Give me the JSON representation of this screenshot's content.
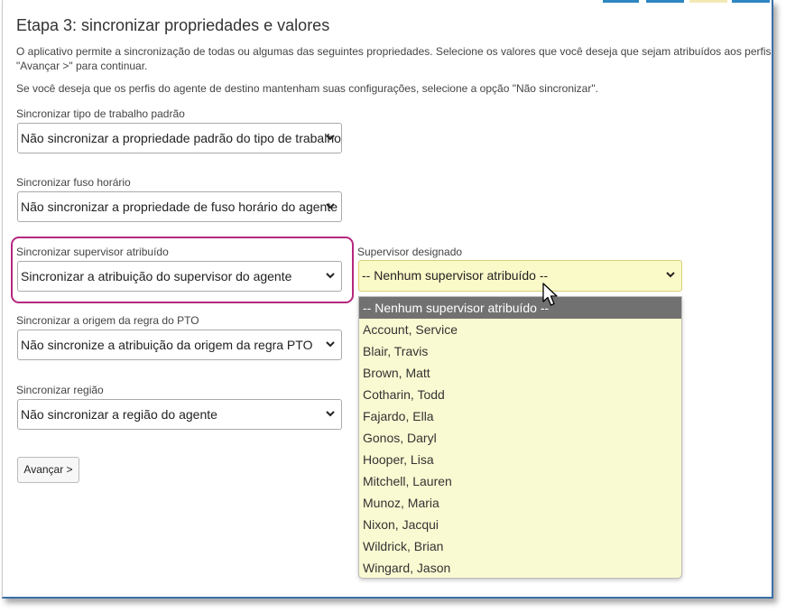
{
  "title": "Etapa 3: sincronizar propriedades e valores",
  "intro": {
    "line1": "O aplicativo permite a sincronização de todas ou algumas das seguintes propriedades. Selecione os valores que você deseja que sejam atribuídos aos perfis de",
    "line2": "\"Avançar >\" para continuar.",
    "line3": "Se você deseja que os perfis do agente de destino mantenham suas configurações, selecione a opção \"Não sincronizar\"."
  },
  "fields": {
    "work_type": {
      "label": "Sincronizar tipo de trabalho padrão",
      "value": "Não sincronizar a propriedade padrão do tipo de trabalho"
    },
    "time_zone": {
      "label": "Sincronizar fuso horário",
      "value": "Não sincronizar a propriedade de fuso horário do agente"
    },
    "supervisor": {
      "label": "Sincronizar supervisor atribuído",
      "value": "Sincronizar a atribuição do supervisor do agente"
    },
    "pto": {
      "label": "Sincronizar a origem da regra do PTO",
      "value": "Não sincronize a atribuição da origem da regra PTO"
    },
    "region": {
      "label": "Sincronizar região",
      "value": "Não sincronizar a região do agente"
    },
    "designated": {
      "label": "Supervisor designado",
      "value": "-- Nenhum supervisor atribuído --"
    }
  },
  "dropdown_options": [
    "-- Nenhum supervisor atribuído --",
    "Account, Service",
    "Blair, Travis",
    "Brown, Matt",
    "Cotharin, Todd",
    "Fajardo, Ella",
    "Gonos, Daryl",
    "Hooper, Lisa",
    "Mitchell, Lauren",
    "Munoz, Maria",
    "Nixon, Jacqui",
    "Wildrick, Brian",
    "Wingard, Jason"
  ],
  "next_button": "Avançar >",
  "colors": {
    "highlight": "#b5287f",
    "dropdown_bg": "#fafad2",
    "active_option": "#717171"
  }
}
